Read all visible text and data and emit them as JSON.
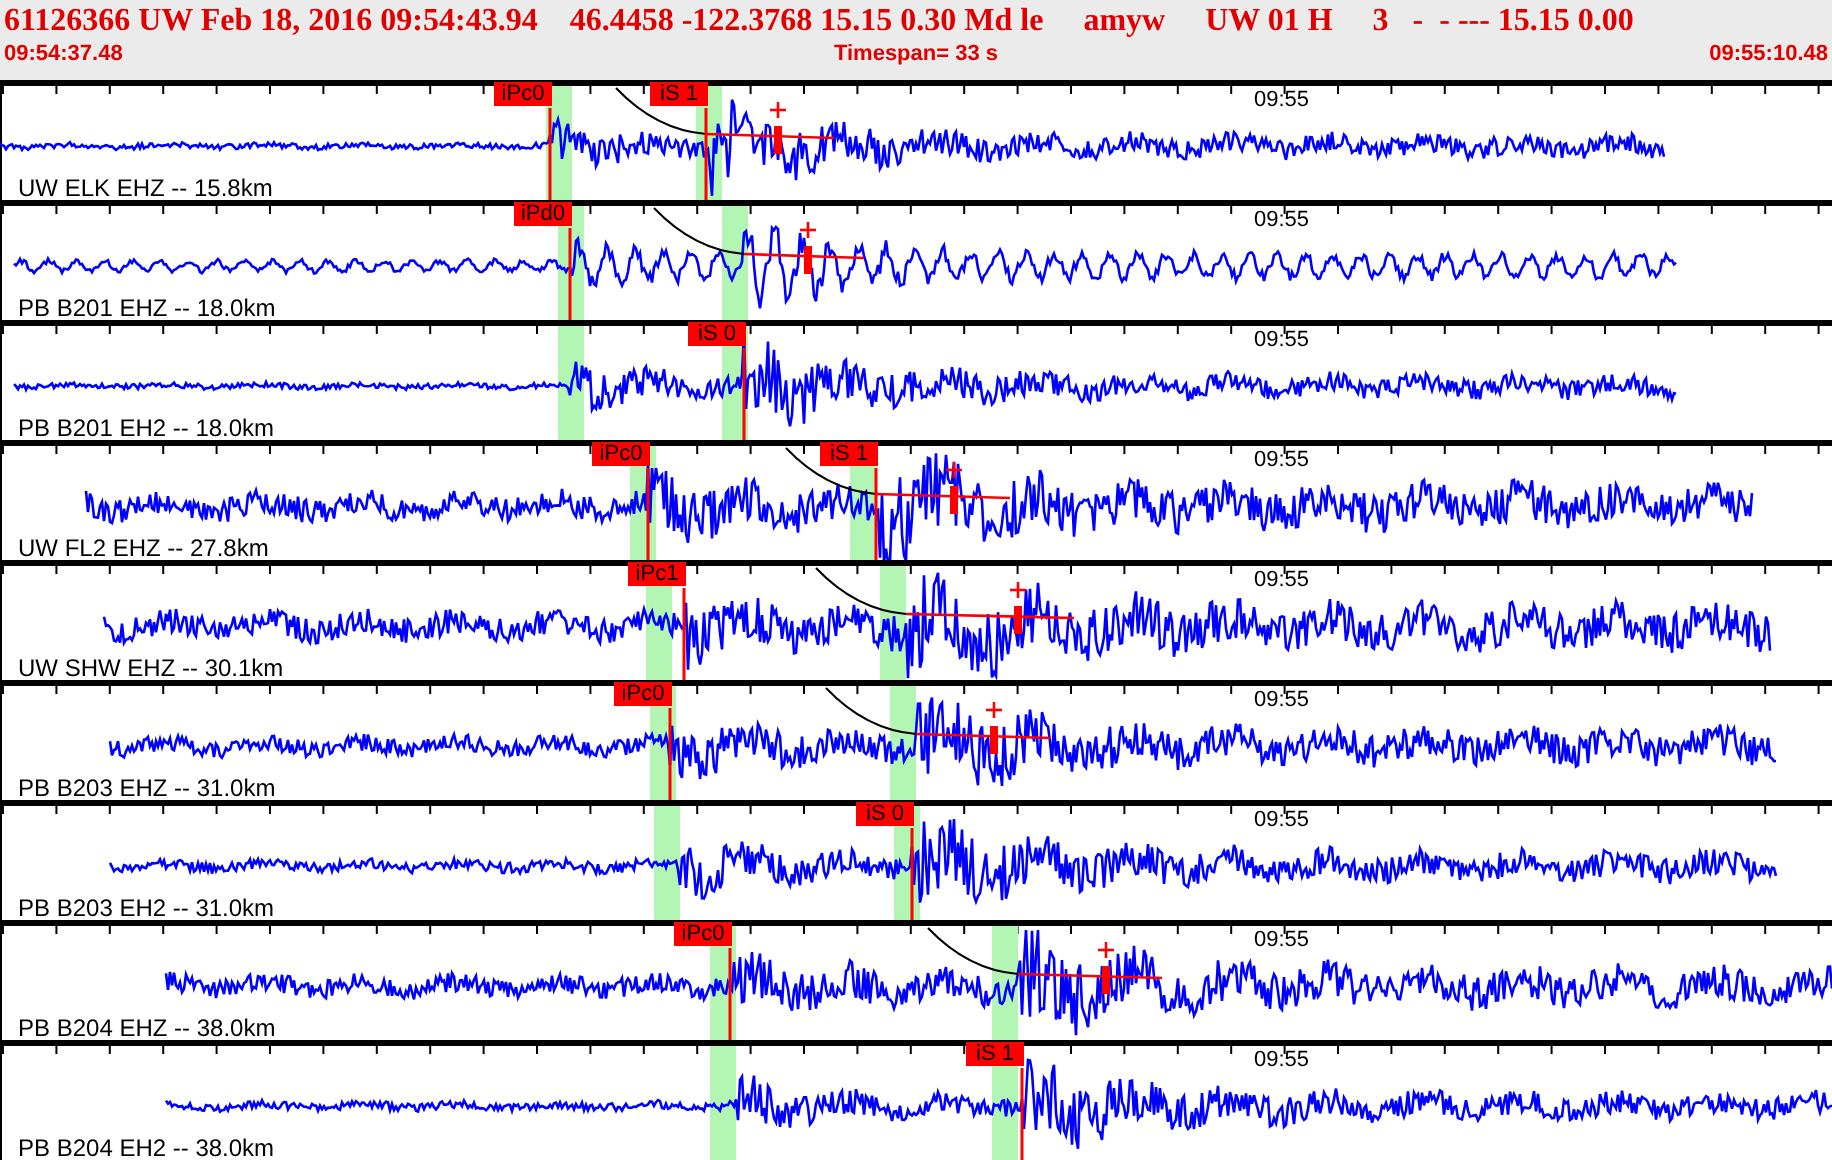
{
  "header": {
    "title": "61126366 UW Feb 18, 2016 09:54:43.94    46.4458 -122.3768 15.15 0.30 Md le     amyw     UW 01 H     3   -  - --- 15.15 0.00",
    "start_time": "09:54:37.48",
    "timespan": "Timespan=  33 s",
    "end_time": "09:55:10.48"
  },
  "traces": [
    {
      "station": "UW ELK EHZ -- 15.8km",
      "time_label": "09:55",
      "picks": [
        {
          "label": "iPc0"
        },
        {
          "label": "iS 1"
        }
      ]
    },
    {
      "station": "PB B201 EHZ -- 18.0km",
      "time_label": "09:55",
      "picks": [
        {
          "label": "iPd0"
        }
      ]
    },
    {
      "station": "PB B201 EH2 -- 18.0km",
      "time_label": "09:55",
      "picks": [
        {
          "label": "iS 0"
        }
      ]
    },
    {
      "station": "UW FL2 EHZ -- 27.8km",
      "time_label": "09:55",
      "picks": [
        {
          "label": "iPc0"
        },
        {
          "label": "iS 1"
        }
      ]
    },
    {
      "station": "UW SHW EHZ -- 30.1km",
      "time_label": "09:55",
      "picks": [
        {
          "label": "iPc1"
        }
      ]
    },
    {
      "station": "PB B203 EHZ -- 31.0km",
      "time_label": "09:55",
      "picks": [
        {
          "label": "iPc0"
        }
      ]
    },
    {
      "station": "PB B203 EH2 -- 31.0km",
      "time_label": "09:55",
      "picks": [
        {
          "label": "iS 0"
        }
      ]
    },
    {
      "station": "PB B204 EHZ -- 38.0km",
      "time_label": "09:55",
      "picks": [
        {
          "label": "iPc0"
        }
      ]
    },
    {
      "station": "PB B204 EH2 -- 38.0km",
      "time_label": "09:55",
      "picks": [
        {
          "label": "iS 1"
        }
      ]
    }
  ]
}
